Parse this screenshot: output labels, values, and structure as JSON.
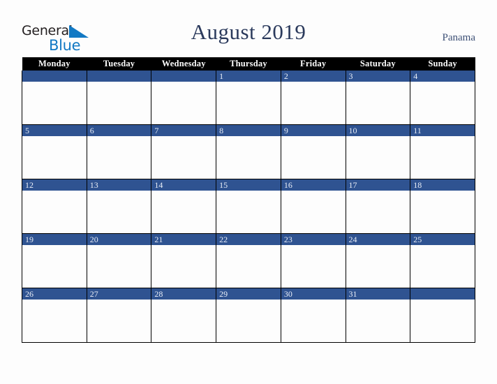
{
  "logo": {
    "word1": "General",
    "word2": "Blue",
    "triangle_color": "#1279c4",
    "word1_color": "#231f20",
    "word2_color": "#1279c4"
  },
  "header": {
    "title": "August 2019",
    "country": "Panama",
    "title_color": "#2b3a5c",
    "country_color": "#3c4f75"
  },
  "calendar": {
    "header_bg": "#000000",
    "header_fg": "#ffffff",
    "daynum_bg": "#2f5391",
    "daynum_fg": "#e8edf6",
    "cell_bg": "#fdfdfd",
    "border_color": "#000000",
    "weekdays": [
      "Monday",
      "Tuesday",
      "Wednesday",
      "Thursday",
      "Friday",
      "Saturday",
      "Sunday"
    ],
    "weeks": [
      [
        "",
        "",
        "",
        "1",
        "2",
        "3",
        "4"
      ],
      [
        "5",
        "6",
        "7",
        "8",
        "9",
        "10",
        "11"
      ],
      [
        "12",
        "13",
        "14",
        "15",
        "16",
        "17",
        "18"
      ],
      [
        "19",
        "20",
        "21",
        "22",
        "23",
        "24",
        "25"
      ],
      [
        "26",
        "27",
        "28",
        "29",
        "30",
        "31",
        ""
      ]
    ]
  }
}
